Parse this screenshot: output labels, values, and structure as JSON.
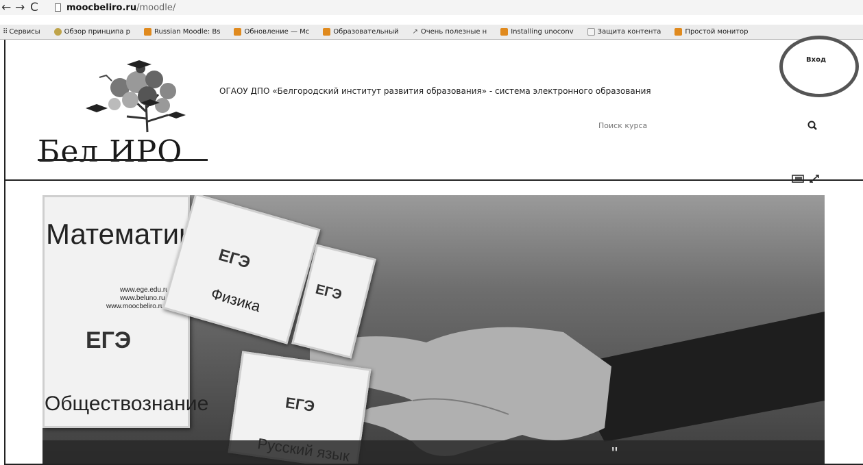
{
  "browser": {
    "url_host": "moocbeliro.ru",
    "url_path": "/moodle/",
    "bookmarks": [
      {
        "label": "Сервисы",
        "icon": "apps-icon"
      },
      {
        "label": "Обзор принципа р",
        "icon": "person-icon"
      },
      {
        "label": "Russian Moodle: Bs",
        "icon": "moodle-icon"
      },
      {
        "label": "Обновление — Mc",
        "icon": "moodle-icon"
      },
      {
        "label": "Образовательный",
        "icon": "moodle-icon"
      },
      {
        "label": "Очень полезные н",
        "icon": "arrow-icon"
      },
      {
        "label": "Installing unoconv",
        "icon": "moodle-icon"
      },
      {
        "label": "Защита контента",
        "icon": "doc-icon"
      },
      {
        "label": "Простой монитор",
        "icon": "moodle-icon"
      }
    ]
  },
  "header": {
    "login_label": "Вход",
    "logo_text": "Бел ИРО",
    "site_title": "ОГАОУ ДПО «Белгородский институт развития образования» - система электронного образования",
    "search_placeholder": "Поиск курса"
  },
  "hero": {
    "cards": [
      "Математик",
      "Физика",
      "Обществознание",
      "Русский язык"
    ],
    "ege_label": "ЕГЭ",
    "card_urls": [
      "www.ege.edu.ru",
      "www.beluno.ru",
      "www.moocbeliro.ru"
    ],
    "band_text": "\""
  },
  "colors": {
    "circle_annotation": "#555555",
    "page_bg": "#ffffff"
  }
}
